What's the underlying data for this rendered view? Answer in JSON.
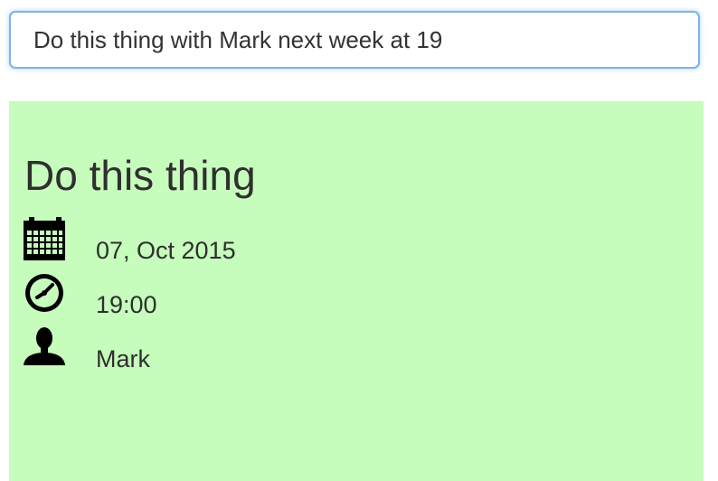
{
  "input": {
    "value": "Do this thing with Mark next week at 19"
  },
  "event": {
    "title": "Do this thing",
    "date": "07, Oct 2015",
    "time": "19:00",
    "person": "Mark"
  },
  "icons": {
    "date": "calendar-icon",
    "time": "clock-icon",
    "person": "person-icon"
  },
  "colors": {
    "card_background": "#c6fcbc",
    "input_focus_border": "#7fb3e6"
  }
}
